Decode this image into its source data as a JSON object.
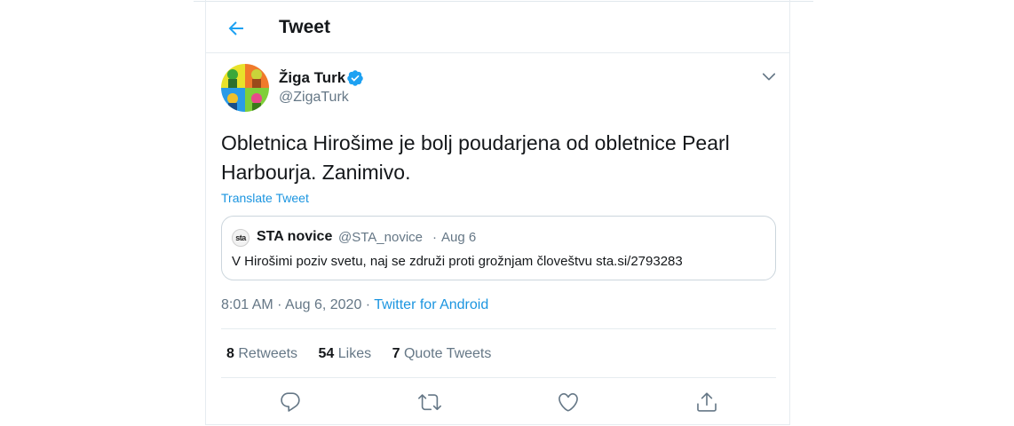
{
  "header": {
    "title": "Tweet"
  },
  "author": {
    "name": "Žiga Turk",
    "handle": "@ZigaTurk"
  },
  "tweet": {
    "text": "Obletnica Hirošime je bolj poudarjena od obletnice Pearl Harbourja. Zanimivo.",
    "translate_label": "Translate Tweet"
  },
  "quote": {
    "logo_text": "sta",
    "name": "STA novice",
    "handle": "@STA_novice",
    "separator": "·",
    "date": "Aug 6",
    "text": "V Hirošimi poziv svetu, naj se združi proti grožnjam človeštvu sta.si/2793283"
  },
  "meta": {
    "time": "8:01 AM",
    "date": "Aug 6, 2020",
    "separator": "·",
    "source": "Twitter for Android"
  },
  "stats": {
    "retweets_count": "8",
    "retweets_label": "Retweets",
    "likes_count": "54",
    "likes_label": "Likes",
    "quotes_count": "7",
    "quotes_label": "Quote Tweets"
  },
  "icons": {
    "back": "arrow-left-icon",
    "verified": "verified-badge-icon",
    "caret": "chevron-down-icon",
    "reply": "reply-icon",
    "retweet": "retweet-icon",
    "like": "heart-icon",
    "share": "share-icon"
  },
  "colors": {
    "accent": "#1da1f2",
    "link": "#1b95e0",
    "text": "#14171a",
    "secondary": "#657786",
    "border": "#e6ecf0"
  }
}
